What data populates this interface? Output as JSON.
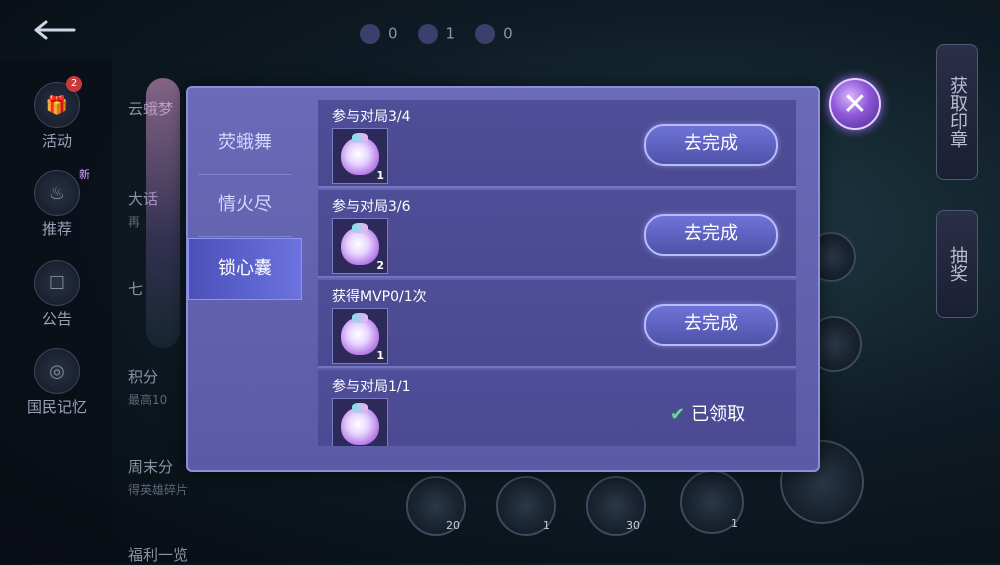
{
  "background": {
    "rail": [
      {
        "label": "活动",
        "icon": "gift-icon",
        "badge": "2"
      },
      {
        "label": "推荐",
        "icon": "flame-icon",
        "badge_new": "新"
      },
      {
        "label": "公告",
        "icon": "notice-icon"
      },
      {
        "label": "国民记忆",
        "icon": "memory-icon"
      }
    ],
    "list": [
      {
        "title": "云蛾梦",
        "sub": ""
      },
      {
        "title": "大话",
        "sub": "再"
      },
      {
        "title": "七",
        "sub": ""
      },
      {
        "title": "积分",
        "sub": "最高10"
      },
      {
        "title": "周末分",
        "sub": "得英雄碎片"
      },
      {
        "title": "福利一览",
        "sub": ""
      }
    ],
    "counters": [
      "0",
      "1",
      "0"
    ],
    "right_tabs": [
      "获取印章",
      "抽奖"
    ],
    "orbs": [
      "20",
      "1",
      "30",
      "1"
    ]
  },
  "dialog": {
    "tabs": [
      "荧蛾舞",
      "情火尽",
      "锁心囊"
    ],
    "active_tab": 2,
    "tasks": [
      {
        "title": "参与对局3/4",
        "item_count": "1",
        "action": "去完成"
      },
      {
        "title": "参与对局3/6",
        "item_count": "2",
        "action": "去完成"
      },
      {
        "title": "获得MVP0/1次",
        "item_count": "1",
        "action": "去完成"
      },
      {
        "title": "参与对局1/1",
        "item_count": "",
        "status": "已领取"
      }
    ]
  },
  "colors": {
    "accent": "#6c73e0",
    "panel": "#5b5aa6",
    "claimed_check": "#5fe08a"
  }
}
